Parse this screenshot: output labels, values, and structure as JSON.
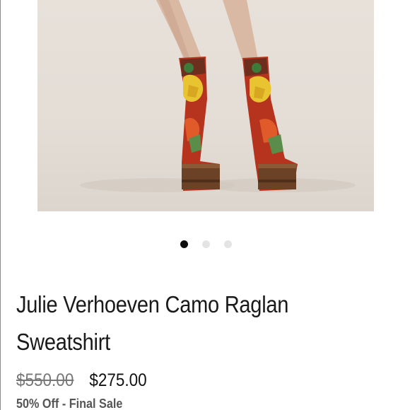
{
  "product": {
    "title": "Julie Verhoeven Camo Raglan Sweatshirt",
    "original_price": "$550.00",
    "sale_price": "$275.00",
    "sale_note": "50% Off - Final Sale"
  },
  "gallery": {
    "image_subject": "product-photo-boots",
    "image_count": 3,
    "active_index": 0
  }
}
